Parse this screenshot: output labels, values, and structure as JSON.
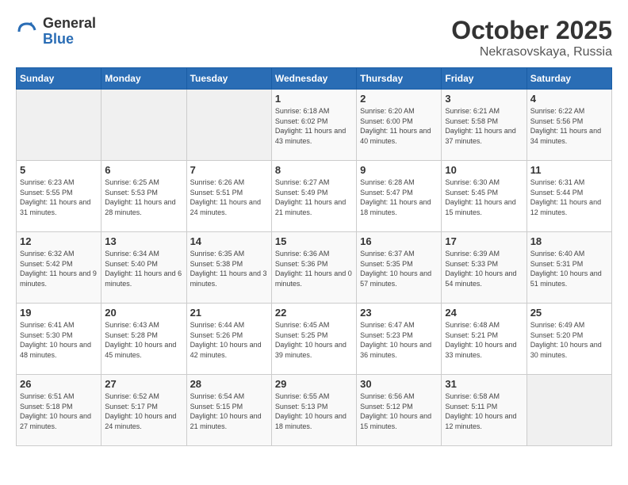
{
  "header": {
    "logo_general": "General",
    "logo_blue": "Blue",
    "title": "October 2025",
    "subtitle": "Nekrasovskaya, Russia"
  },
  "weekdays": [
    "Sunday",
    "Monday",
    "Tuesday",
    "Wednesday",
    "Thursday",
    "Friday",
    "Saturday"
  ],
  "weeks": [
    [
      {
        "day": "",
        "empty": true
      },
      {
        "day": "",
        "empty": true
      },
      {
        "day": "",
        "empty": true
      },
      {
        "day": "1",
        "sunrise": "6:18 AM",
        "sunset": "6:02 PM",
        "daylight": "11 hours and 43 minutes."
      },
      {
        "day": "2",
        "sunrise": "6:20 AM",
        "sunset": "6:00 PM",
        "daylight": "11 hours and 40 minutes."
      },
      {
        "day": "3",
        "sunrise": "6:21 AM",
        "sunset": "5:58 PM",
        "daylight": "11 hours and 37 minutes."
      },
      {
        "day": "4",
        "sunrise": "6:22 AM",
        "sunset": "5:56 PM",
        "daylight": "11 hours and 34 minutes."
      }
    ],
    [
      {
        "day": "5",
        "sunrise": "6:23 AM",
        "sunset": "5:55 PM",
        "daylight": "11 hours and 31 minutes."
      },
      {
        "day": "6",
        "sunrise": "6:25 AM",
        "sunset": "5:53 PM",
        "daylight": "11 hours and 28 minutes."
      },
      {
        "day": "7",
        "sunrise": "6:26 AM",
        "sunset": "5:51 PM",
        "daylight": "11 hours and 24 minutes."
      },
      {
        "day": "8",
        "sunrise": "6:27 AM",
        "sunset": "5:49 PM",
        "daylight": "11 hours and 21 minutes."
      },
      {
        "day": "9",
        "sunrise": "6:28 AM",
        "sunset": "5:47 PM",
        "daylight": "11 hours and 18 minutes."
      },
      {
        "day": "10",
        "sunrise": "6:30 AM",
        "sunset": "5:45 PM",
        "daylight": "11 hours and 15 minutes."
      },
      {
        "day": "11",
        "sunrise": "6:31 AM",
        "sunset": "5:44 PM",
        "daylight": "11 hours and 12 minutes."
      }
    ],
    [
      {
        "day": "12",
        "sunrise": "6:32 AM",
        "sunset": "5:42 PM",
        "daylight": "11 hours and 9 minutes."
      },
      {
        "day": "13",
        "sunrise": "6:34 AM",
        "sunset": "5:40 PM",
        "daylight": "11 hours and 6 minutes."
      },
      {
        "day": "14",
        "sunrise": "6:35 AM",
        "sunset": "5:38 PM",
        "daylight": "11 hours and 3 minutes."
      },
      {
        "day": "15",
        "sunrise": "6:36 AM",
        "sunset": "5:36 PM",
        "daylight": "11 hours and 0 minutes."
      },
      {
        "day": "16",
        "sunrise": "6:37 AM",
        "sunset": "5:35 PM",
        "daylight": "10 hours and 57 minutes."
      },
      {
        "day": "17",
        "sunrise": "6:39 AM",
        "sunset": "5:33 PM",
        "daylight": "10 hours and 54 minutes."
      },
      {
        "day": "18",
        "sunrise": "6:40 AM",
        "sunset": "5:31 PM",
        "daylight": "10 hours and 51 minutes."
      }
    ],
    [
      {
        "day": "19",
        "sunrise": "6:41 AM",
        "sunset": "5:30 PM",
        "daylight": "10 hours and 48 minutes."
      },
      {
        "day": "20",
        "sunrise": "6:43 AM",
        "sunset": "5:28 PM",
        "daylight": "10 hours and 45 minutes."
      },
      {
        "day": "21",
        "sunrise": "6:44 AM",
        "sunset": "5:26 PM",
        "daylight": "10 hours and 42 minutes."
      },
      {
        "day": "22",
        "sunrise": "6:45 AM",
        "sunset": "5:25 PM",
        "daylight": "10 hours and 39 minutes."
      },
      {
        "day": "23",
        "sunrise": "6:47 AM",
        "sunset": "5:23 PM",
        "daylight": "10 hours and 36 minutes."
      },
      {
        "day": "24",
        "sunrise": "6:48 AM",
        "sunset": "5:21 PM",
        "daylight": "10 hours and 33 minutes."
      },
      {
        "day": "25",
        "sunrise": "6:49 AM",
        "sunset": "5:20 PM",
        "daylight": "10 hours and 30 minutes."
      }
    ],
    [
      {
        "day": "26",
        "sunrise": "6:51 AM",
        "sunset": "5:18 PM",
        "daylight": "10 hours and 27 minutes."
      },
      {
        "day": "27",
        "sunrise": "6:52 AM",
        "sunset": "5:17 PM",
        "daylight": "10 hours and 24 minutes."
      },
      {
        "day": "28",
        "sunrise": "6:54 AM",
        "sunset": "5:15 PM",
        "daylight": "10 hours and 21 minutes."
      },
      {
        "day": "29",
        "sunrise": "6:55 AM",
        "sunset": "5:13 PM",
        "daylight": "10 hours and 18 minutes."
      },
      {
        "day": "30",
        "sunrise": "6:56 AM",
        "sunset": "5:12 PM",
        "daylight": "10 hours and 15 minutes."
      },
      {
        "day": "31",
        "sunrise": "6:58 AM",
        "sunset": "5:11 PM",
        "daylight": "10 hours and 12 minutes."
      },
      {
        "day": "",
        "empty": true
      }
    ]
  ]
}
